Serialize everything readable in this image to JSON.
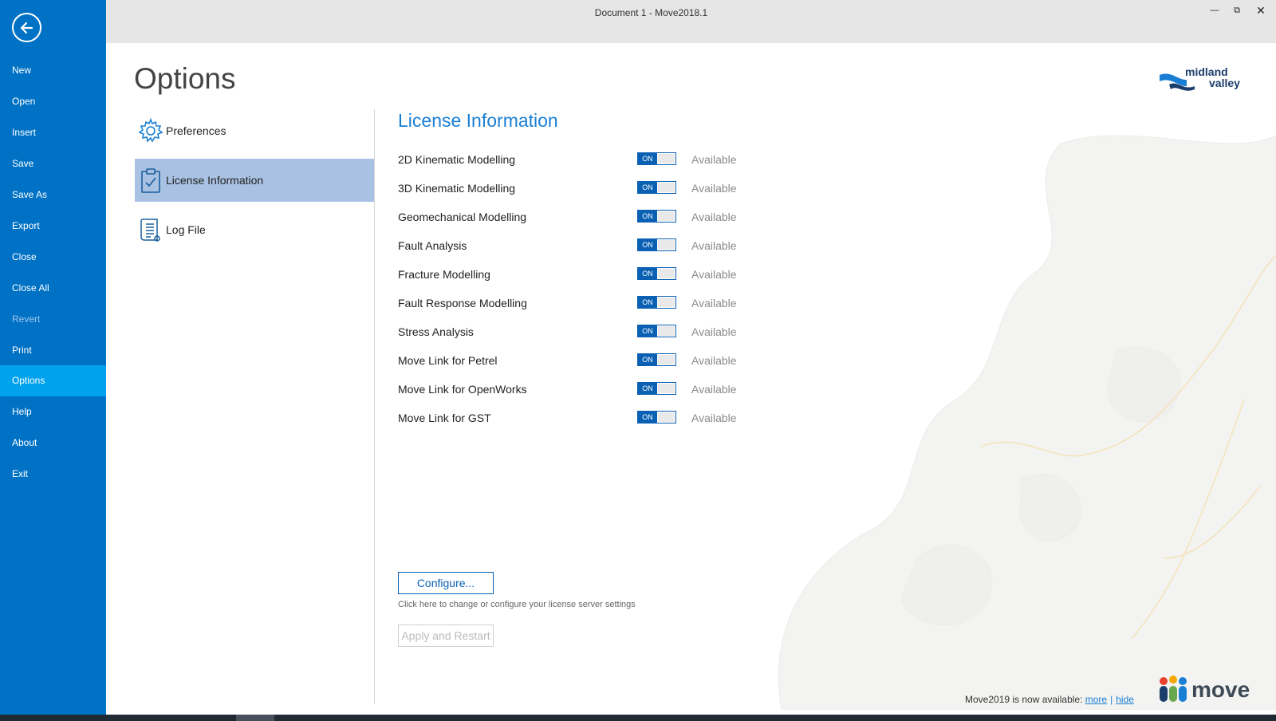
{
  "window": {
    "title": "Document 1 - Move2018.1"
  },
  "nav": {
    "items": [
      {
        "label": "New"
      },
      {
        "label": "Open"
      },
      {
        "label": "Insert"
      },
      {
        "label": "Save"
      },
      {
        "label": "Save As"
      },
      {
        "label": "Export"
      },
      {
        "label": "Close"
      },
      {
        "label": "Close All"
      },
      {
        "label": "Revert",
        "disabled": true
      },
      {
        "label": "Print"
      },
      {
        "label": "Options",
        "active": true
      },
      {
        "label": "Help"
      },
      {
        "label": "About"
      },
      {
        "label": "Exit"
      }
    ]
  },
  "page": {
    "title": "Options"
  },
  "brand": {
    "line1": "midland",
    "line2": "valley",
    "product": "move"
  },
  "sidebar": {
    "items": [
      {
        "label": "Preferences",
        "icon": "gear-icon"
      },
      {
        "label": "License Information",
        "icon": "clipboard-check-icon",
        "active": true
      },
      {
        "label": "Log File",
        "icon": "document-list-icon"
      }
    ]
  },
  "license": {
    "title": "License Information",
    "toggle_label": "ON",
    "features": [
      {
        "name": "2D Kinematic Modelling",
        "status": "Available"
      },
      {
        "name": "3D Kinematic Modelling",
        "status": "Available"
      },
      {
        "name": "Geomechanical Modelling",
        "status": "Available"
      },
      {
        "name": "Fault Analysis",
        "status": "Available"
      },
      {
        "name": "Fracture Modelling",
        "status": "Available"
      },
      {
        "name": "Fault Response Modelling",
        "status": "Available"
      },
      {
        "name": "Stress Analysis",
        "status": "Available"
      },
      {
        "name": "Move Link for Petrel",
        "status": "Available"
      },
      {
        "name": "Move Link for OpenWorks",
        "status": "Available"
      },
      {
        "name": "Move Link for GST",
        "status": "Available"
      }
    ],
    "configure_label": "Configure...",
    "configure_hint": "Click here to change or configure your license server settings",
    "apply_label": "Apply and Restart"
  },
  "notice": {
    "text": "Move2019 is now available:",
    "more": "more",
    "separator": "|",
    "hide": "hide"
  },
  "colors": {
    "nav_bg": "#0072c6",
    "nav_active": "#00a2ed",
    "accent": "#1a7fd4",
    "sidebar_active": "#a9c1e2"
  }
}
